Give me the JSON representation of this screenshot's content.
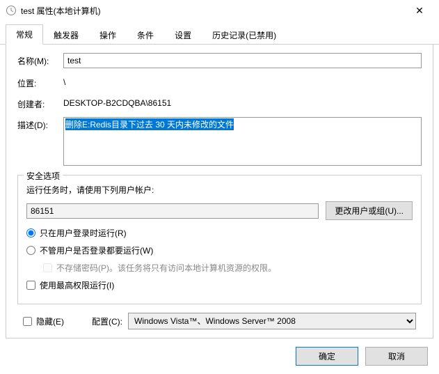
{
  "window": {
    "title": "test 属性(本地计算机)"
  },
  "tabs": [
    {
      "id": "general",
      "label": "常规",
      "active": true
    },
    {
      "id": "triggers",
      "label": "触发器",
      "active": false
    },
    {
      "id": "actions",
      "label": "操作",
      "active": false
    },
    {
      "id": "conditions",
      "label": "条件",
      "active": false
    },
    {
      "id": "settings",
      "label": "设置",
      "active": false
    },
    {
      "id": "history",
      "label": "历史记录(已禁用)",
      "active": false
    }
  ],
  "general": {
    "name_label": "名称(M):",
    "name_value": "test",
    "location_label": "位置:",
    "location_value": "\\",
    "creator_label": "创建者:",
    "creator_value": "DESKTOP-B2CDQBA\\86151",
    "desc_label": "描述(D):",
    "desc_value": "删除E:Redis目录下过去 30 天内未修改的文件"
  },
  "security": {
    "legend": "安全选项",
    "runas_label": "运行任务时，请使用下列用户帐户:",
    "runas_user": "86151",
    "change_user_btn": "更改用户或组(U)...",
    "radio_logged_on": "只在用户登录时运行(R)",
    "radio_any": "不管用户是否登录都要运行(W)",
    "no_store_pw": "不存储密码(P)。该任务将只有访问本地计算机资源的权限。",
    "highest_priv": "使用最高权限运行(I)"
  },
  "bottom": {
    "hidden_label": "隐藏(E)",
    "config_label": "配置(C):",
    "config_value": "Windows Vista™、Windows Server™ 2008"
  },
  "footer": {
    "ok": "确定",
    "cancel": "取消"
  }
}
